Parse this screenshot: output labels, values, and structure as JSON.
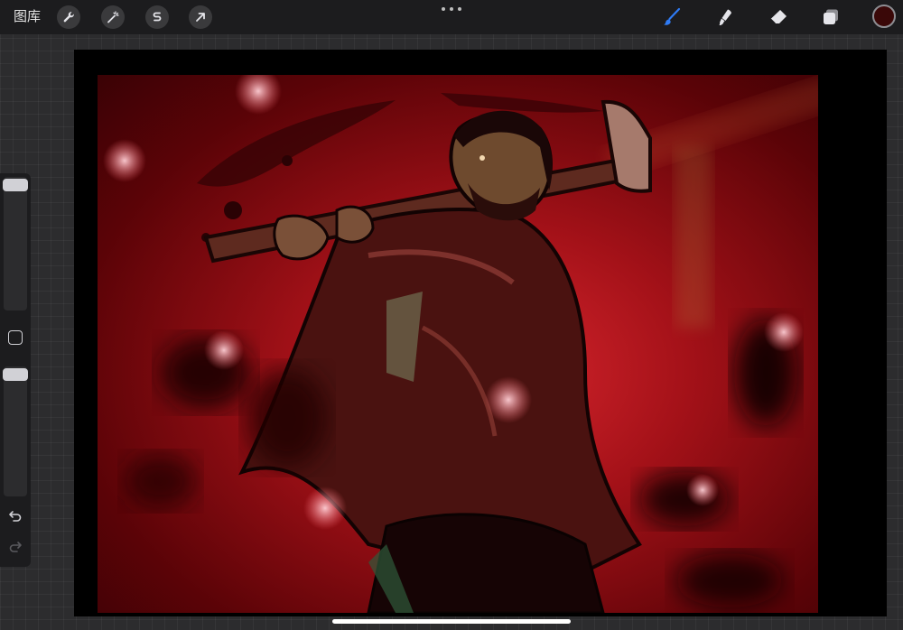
{
  "topbar": {
    "gallery_label": "图库",
    "left_tools": [
      {
        "name": "actions",
        "icon": "wrench-icon"
      },
      {
        "name": "adjustments",
        "icon": "magic-wand-icon"
      },
      {
        "name": "selection",
        "icon": "selection-s-icon"
      },
      {
        "name": "transform",
        "icon": "arrow-cursor-icon"
      }
    ],
    "more_icon": "ellipsis-icon",
    "right_tools": [
      {
        "name": "brush",
        "icon": "brush-icon",
        "active": true
      },
      {
        "name": "smudge",
        "icon": "smudge-icon",
        "active": false
      },
      {
        "name": "eraser",
        "icon": "eraser-icon",
        "active": false
      },
      {
        "name": "layers",
        "icon": "layers-icon",
        "active": false
      }
    ],
    "current_color": "#3a0808",
    "accent_color": "#2f7bf5"
  },
  "sidebar": {
    "brush_size_level": 0.0,
    "opacity_level": 0.0,
    "modify_icon": "square-modify-icon",
    "undo_icon": "undo-icon",
    "redo_icon": "redo-icon"
  }
}
